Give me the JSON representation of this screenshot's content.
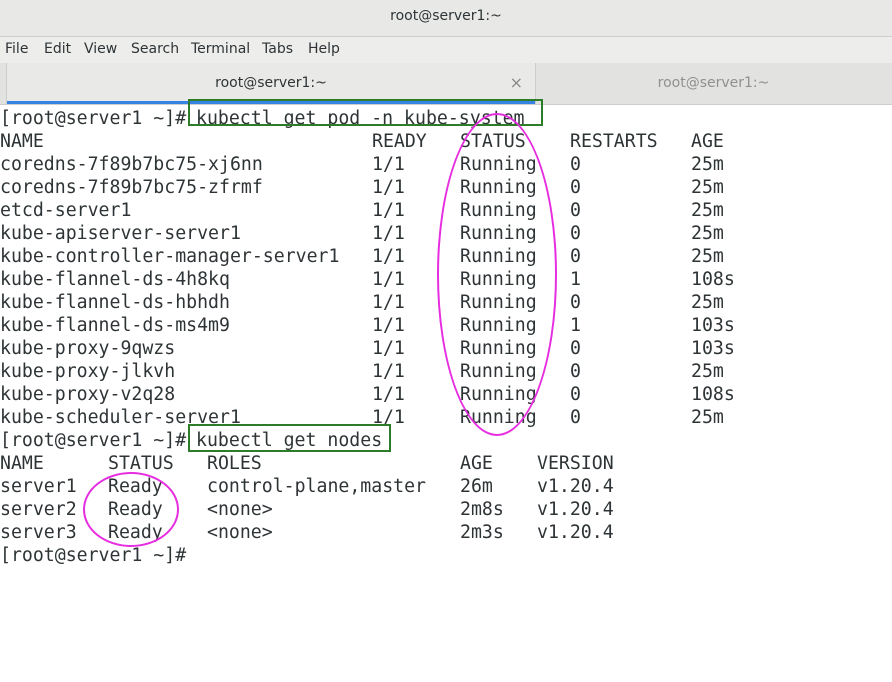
{
  "window": {
    "title": "root@server1:~"
  },
  "menu": [
    "File",
    "Edit",
    "View",
    "Search",
    "Terminal",
    "Tabs",
    "Help"
  ],
  "tabs": [
    {
      "label": "root@server1:~",
      "active": true,
      "close_glyph": "×"
    },
    {
      "label": "root@server1:~",
      "active": false
    }
  ],
  "terminal": {
    "prompt": "[root@server1 ~]#",
    "command1": "kubectl get pod -n kube-system",
    "pods_header": {
      "name": "NAME",
      "ready": "READY",
      "status": "STATUS",
      "restarts": "RESTARTS",
      "age": "AGE"
    },
    "pods": [
      {
        "name": "coredns-7f89b7bc75-xj6nn",
        "ready": "1/1",
        "status": "Running",
        "restarts": "0",
        "age": "25m"
      },
      {
        "name": "coredns-7f89b7bc75-zfrmf",
        "ready": "1/1",
        "status": "Running",
        "restarts": "0",
        "age": "25m"
      },
      {
        "name": "etcd-server1",
        "ready": "1/1",
        "status": "Running",
        "restarts": "0",
        "age": "25m"
      },
      {
        "name": "kube-apiserver-server1",
        "ready": "1/1",
        "status": "Running",
        "restarts": "0",
        "age": "25m"
      },
      {
        "name": "kube-controller-manager-server1",
        "ready": "1/1",
        "status": "Running",
        "restarts": "0",
        "age": "25m"
      },
      {
        "name": "kube-flannel-ds-4h8kq",
        "ready": "1/1",
        "status": "Running",
        "restarts": "1",
        "age": "108s"
      },
      {
        "name": "kube-flannel-ds-hbhdh",
        "ready": "1/1",
        "status": "Running",
        "restarts": "0",
        "age": "25m"
      },
      {
        "name": "kube-flannel-ds-ms4m9",
        "ready": "1/1",
        "status": "Running",
        "restarts": "1",
        "age": "103s"
      },
      {
        "name": "kube-proxy-9qwzs",
        "ready": "1/1",
        "status": "Running",
        "restarts": "0",
        "age": "103s"
      },
      {
        "name": "kube-proxy-jlkvh",
        "ready": "1/1",
        "status": "Running",
        "restarts": "0",
        "age": "25m"
      },
      {
        "name": "kube-proxy-v2q28",
        "ready": "1/1",
        "status": "Running",
        "restarts": "0",
        "age": "108s"
      },
      {
        "name": "kube-scheduler-server1",
        "ready": "1/1",
        "status": "Running",
        "restarts": "0",
        "age": "25m"
      }
    ],
    "command2": "kubectl get nodes",
    "nodes_header": {
      "name": "NAME",
      "status": "STATUS",
      "roles": "ROLES",
      "age": "AGE",
      "version": "VERSION"
    },
    "nodes": [
      {
        "name": "server1",
        "status": "Ready",
        "roles": "control-plane,master",
        "age": "26m",
        "version": "v1.20.4"
      },
      {
        "name": "server2",
        "status": "Ready",
        "roles": "<none>",
        "age": "2m8s",
        "version": "v1.20.4"
      },
      {
        "name": "server3",
        "status": "Ready",
        "roles": "<none>",
        "age": "2m3s",
        "version": "v1.20.4"
      }
    ]
  },
  "annotation_colors": {
    "box": "#2d7d28",
    "ellipse": "#e62ee0"
  }
}
